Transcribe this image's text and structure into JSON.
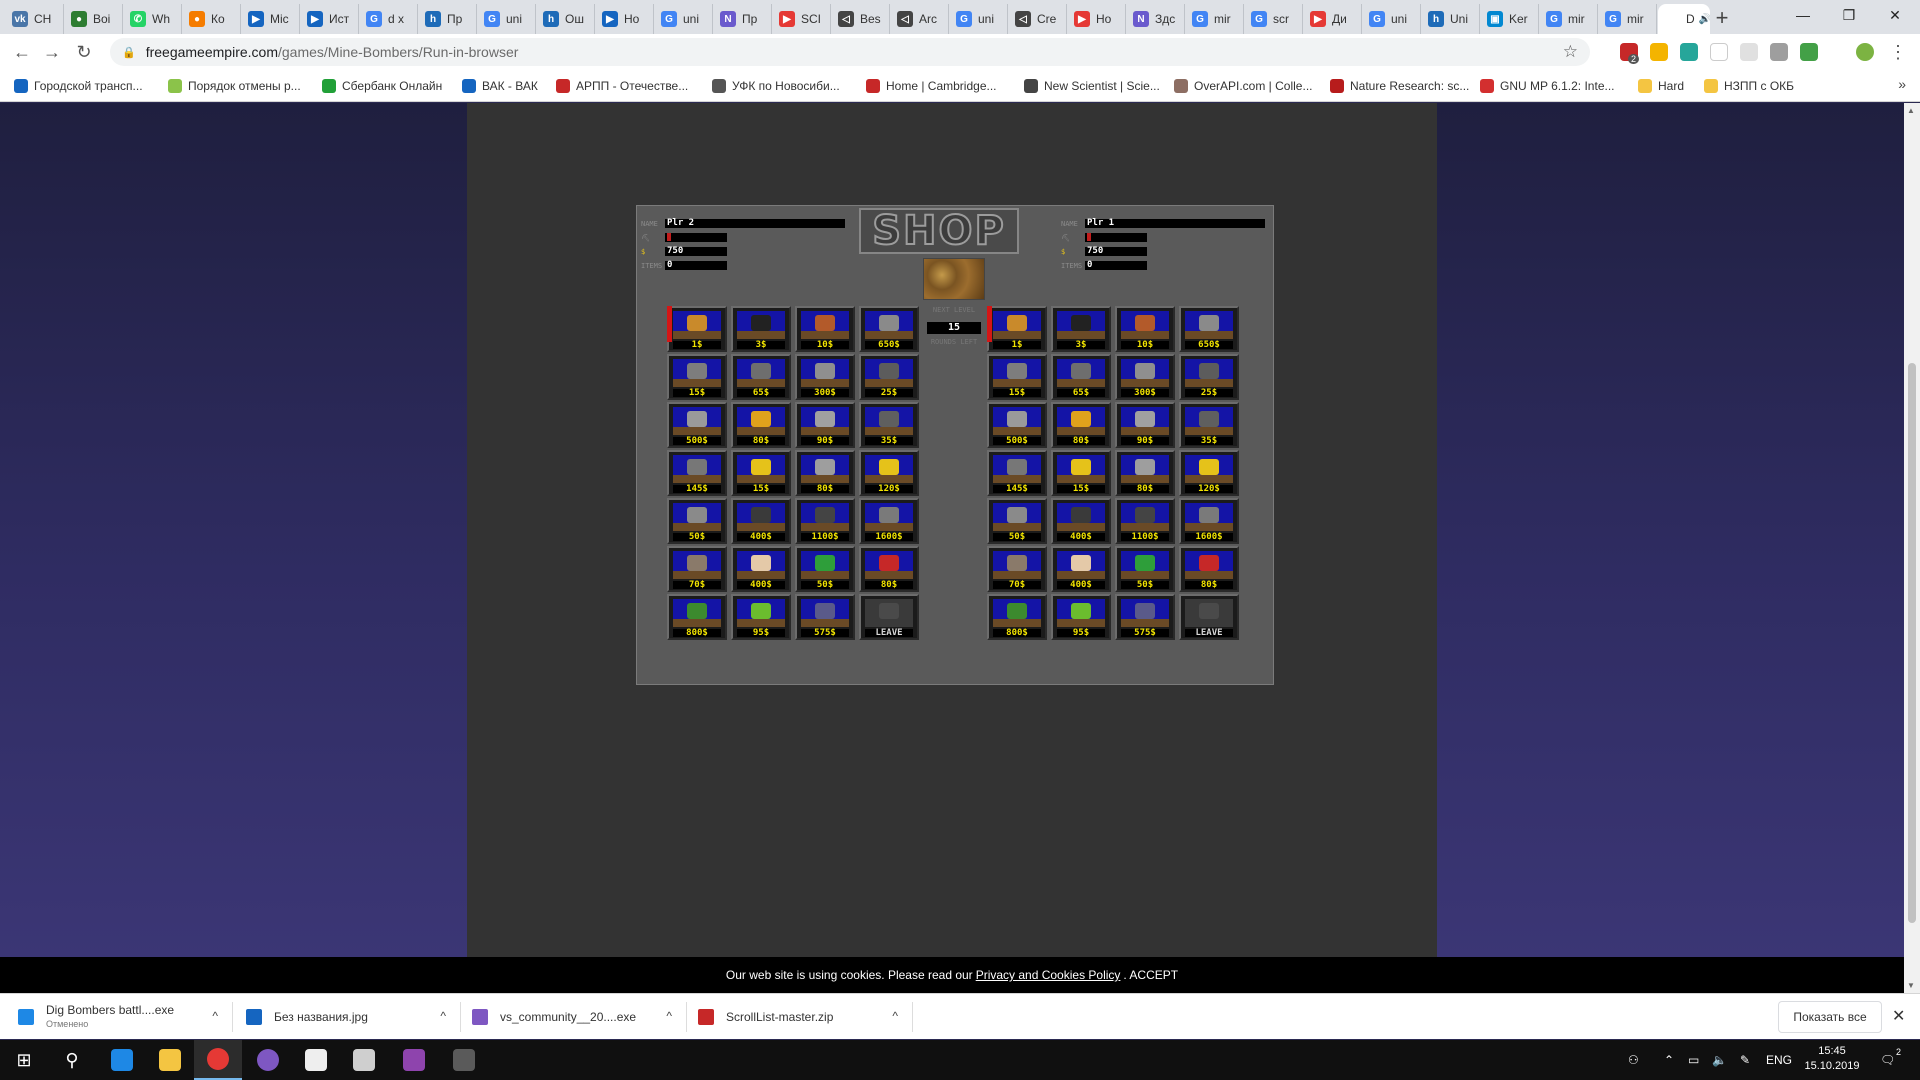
{
  "browser": {
    "tabs": [
      {
        "label": "СН",
        "color": "#4a76a8",
        "glyph": "vk"
      },
      {
        "label": "Воі",
        "color": "#2e7d32",
        "glyph": "●"
      },
      {
        "label": "Wh",
        "color": "#25d366",
        "glyph": "✆"
      },
      {
        "label": "Ко",
        "color": "#f57c00",
        "glyph": "●"
      },
      {
        "label": "Mic",
        "color": "#1565c0",
        "glyph": "▶"
      },
      {
        "label": "Ист",
        "color": "#1565c0",
        "glyph": "▶"
      },
      {
        "label": "d x",
        "color": "#4285f4",
        "glyph": "G"
      },
      {
        "label": "Пр",
        "color": "#1e6bb8",
        "glyph": "h"
      },
      {
        "label": "uni",
        "color": "#4285f4",
        "glyph": "G"
      },
      {
        "label": "Ош",
        "color": "#1e6bb8",
        "glyph": "h"
      },
      {
        "label": "Ho",
        "color": "#1565c0",
        "glyph": "▶"
      },
      {
        "label": "uni",
        "color": "#4285f4",
        "glyph": "G"
      },
      {
        "label": "Пр",
        "color": "#6a5acd",
        "glyph": "N"
      },
      {
        "label": "SCI",
        "color": "#e53935",
        "glyph": "▶"
      },
      {
        "label": "Bes",
        "color": "#444444",
        "glyph": "◁"
      },
      {
        "label": "Arc",
        "color": "#444444",
        "glyph": "◁"
      },
      {
        "label": "uni",
        "color": "#4285f4",
        "glyph": "G"
      },
      {
        "label": "Cre",
        "color": "#444444",
        "glyph": "◁"
      },
      {
        "label": "Ho",
        "color": "#e53935",
        "glyph": "▶"
      },
      {
        "label": "Здс",
        "color": "#6a5acd",
        "glyph": "N"
      },
      {
        "label": "mir",
        "color": "#4285f4",
        "glyph": "G"
      },
      {
        "label": "scr",
        "color": "#4285f4",
        "glyph": "G"
      },
      {
        "label": "Ди",
        "color": "#e53935",
        "glyph": "▶"
      },
      {
        "label": "uni",
        "color": "#4285f4",
        "glyph": "G"
      },
      {
        "label": "Uni",
        "color": "#1e6bb8",
        "glyph": "h"
      },
      {
        "label": "Ker",
        "color": "#0288d1",
        "glyph": "▣"
      },
      {
        "label": "mir",
        "color": "#4285f4",
        "glyph": "G"
      },
      {
        "label": "mir",
        "color": "#4285f4",
        "glyph": "G"
      },
      {
        "label": "D",
        "color": "#ffffff",
        "glyph": "",
        "active": true
      }
    ],
    "new_tab_glyph": "+",
    "window_controls": {
      "minimize": "—",
      "restore": "❐",
      "close": "✕"
    },
    "nav": {
      "back": "←",
      "forward": "→",
      "reload": "↻"
    },
    "url_host": "freegameempire.com",
    "url_path": "/games/Mine-Bombers/Run-in-browser",
    "bookmark_star": "☆",
    "menu_dots": "⋮",
    "extension_badge": "2",
    "bookmarks": [
      {
        "label": "Городской трансп...",
        "color": "#1565c0"
      },
      {
        "label": "Порядок отмены р...",
        "color": "#8bc34a"
      },
      {
        "label": "Сбербанк Онлайн",
        "color": "#21a038"
      },
      {
        "label": "ВАК - ВАК",
        "color": "#1565c0"
      },
      {
        "label": "АРПП - Отечестве...",
        "color": "#c62828"
      },
      {
        "label": "УФК по Новосиби...",
        "color": "#555555"
      },
      {
        "label": "Home | Cambridge...",
        "color": "#c62828"
      },
      {
        "label": "New Scientist | Scie...",
        "color": "#444444"
      },
      {
        "label": "OverAPI.com | Colle...",
        "color": "#8d6e63"
      },
      {
        "label": "Nature Research: sc...",
        "color": "#b71c1c"
      },
      {
        "label": "GNU MP 6.1.2: Inte...",
        "color": "#d32f2f"
      },
      {
        "label": "Hard",
        "color": "#f4c542"
      },
      {
        "label": "НЗПП с ОКБ",
        "color": "#f4c542"
      }
    ],
    "bookmarks_more": "»"
  },
  "game": {
    "shop_title": "SHOP",
    "left_player": {
      "name_label": "NAME",
      "name": "Plr 2",
      "money_symbol": "$",
      "money": "750",
      "items_label": "ITEMS",
      "items": "0"
    },
    "right_player": {
      "name_label": "NAME",
      "name": "Plr 1",
      "money_symbol": "$",
      "money": "750",
      "items_label": "ITEMS",
      "items": "0"
    },
    "next_level_label": "NEXT LEVEL",
    "rounds_value": "15",
    "rounds_label": "ROUNDS LEFT",
    "items": [
      {
        "price": "1$",
        "color": "#c98a2b",
        "selected": true
      },
      {
        "price": "3$",
        "color": "#222222"
      },
      {
        "price": "10$",
        "color": "#b35a2a"
      },
      {
        "price": "650$",
        "color": "#8a8a8a"
      },
      {
        "price": "15$",
        "color": "#7d7d7d"
      },
      {
        "price": "65$",
        "color": "#6e6e6e"
      },
      {
        "price": "300$",
        "color": "#8f8f8f"
      },
      {
        "price": "25$",
        "color": "#5c5c5c"
      },
      {
        "price": "500$",
        "color": "#9a9a9a"
      },
      {
        "price": "80$",
        "color": "#e0a21c"
      },
      {
        "price": "90$",
        "color": "#a0a0a0"
      },
      {
        "price": "35$",
        "color": "#5f5f5f"
      },
      {
        "price": "145$",
        "color": "#777777"
      },
      {
        "price": "15$",
        "color": "#e5c21a"
      },
      {
        "price": "80$",
        "color": "#9e9e9e"
      },
      {
        "price": "120$",
        "color": "#e5c21a"
      },
      {
        "price": "50$",
        "color": "#8a8a8a"
      },
      {
        "price": "400$",
        "color": "#3a3a3a"
      },
      {
        "price": "1100$",
        "color": "#444444"
      },
      {
        "price": "1600$",
        "color": "#7a7a7a"
      },
      {
        "price": "70$",
        "color": "#8a7a6a"
      },
      {
        "price": "400$",
        "color": "#e4c9a8"
      },
      {
        "price": "50$",
        "color": "#2e9e3a"
      },
      {
        "price": "80$",
        "color": "#c62828"
      },
      {
        "price": "800$",
        "color": "#3c8a2e"
      },
      {
        "price": "95$",
        "color": "#6bbd2e"
      },
      {
        "price": "575$",
        "color": "#5a5a8a"
      },
      {
        "price": "LEAVE",
        "color": "#4a4a4a",
        "leave": true
      }
    ]
  },
  "cookie": {
    "before": "Our web site is using cookies. Please read our",
    "link": "Privacy and Cookies Policy",
    "after": ". ACCEPT"
  },
  "downloads": {
    "items": [
      {
        "name": "Dig Bombers battl....exe",
        "sub": "Отменено",
        "color": "#1e88e5"
      },
      {
        "name": "Без названия.jpg",
        "sub": "",
        "color": "#1565c0"
      },
      {
        "name": "vs_community__20....exe",
        "sub": "",
        "color": "#7e57c2"
      },
      {
        "name": "ScrollList-master.zip",
        "sub": "",
        "color": "#c62828"
      }
    ],
    "show_all": "Показать все",
    "close": "✕",
    "chevron": "^"
  },
  "taskbar": {
    "lang": "ENG",
    "time": "15:45",
    "date": "15.10.2019",
    "notif_count": "2"
  }
}
